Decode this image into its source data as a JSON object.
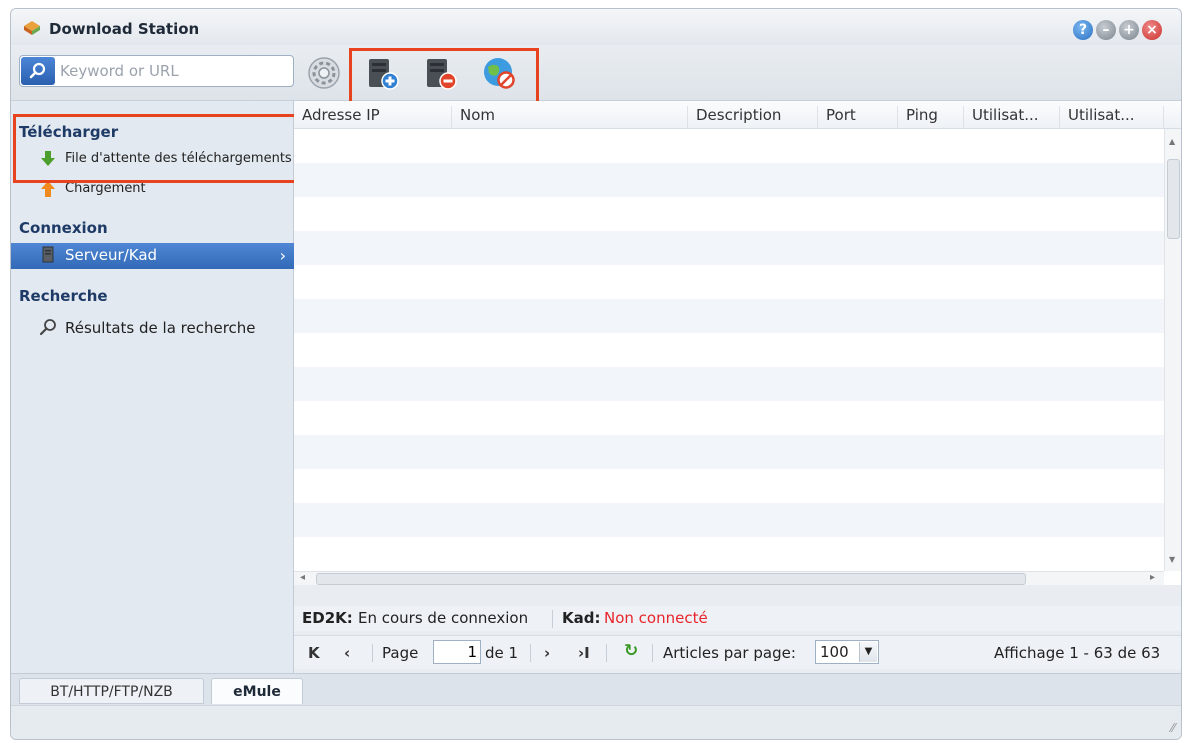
{
  "window": {
    "title": "Download Station",
    "controls": [
      "help",
      "minimize",
      "maximize",
      "close"
    ]
  },
  "colors": {
    "accent": "#336ab8",
    "highlight_box": "#e8431f",
    "status_error": "#e8252b"
  },
  "toolbar": {
    "search_placeholder": "Keyword or URL",
    "buttons": [
      {
        "icon": "gear-icon",
        "name": "settings"
      },
      {
        "icon": "add-server-icon",
        "name": "add-server"
      },
      {
        "icon": "remove-server-icon",
        "name": "remove-server"
      },
      {
        "icon": "block-network-icon",
        "name": "disconnect"
      }
    ]
  },
  "sidebar": {
    "sections": [
      {
        "title": "Télécharger",
        "items": [
          {
            "label": "File d'attente des téléchargements",
            "icon": "download-arrow-icon"
          },
          {
            "label": "Chargement",
            "icon": "upload-arrow-icon"
          }
        ]
      },
      {
        "title": "Connexion",
        "items": [
          {
            "label": "Serveur/Kad",
            "icon": "server-icon",
            "active": true
          }
        ]
      },
      {
        "title": "Recherche",
        "items": [
          {
            "label": "Résultats de la recherche",
            "icon": "search-icon"
          }
        ]
      }
    ]
  },
  "grid": {
    "columns": [
      "Adresse IP",
      "Nom",
      "Description",
      "Port",
      "Ping",
      "Utilisat...",
      "Utilisat..."
    ],
    "rows": []
  },
  "status": {
    "ed2k_label": "ED2K:",
    "ed2k_value": "En cours de connexion",
    "kad_label": "Kad:",
    "kad_value": "Non connecté"
  },
  "pager": {
    "page_label": "Page",
    "page_value": "1",
    "of_label": "de 1",
    "per_page_label": "Articles par page:",
    "per_page_value": "100",
    "display_text": "Affichage 1 - 63 de 63"
  },
  "bottom_tabs": [
    {
      "label": "BT/HTTP/FTP/NZB",
      "active": false
    },
    {
      "label": "eMule",
      "active": true
    }
  ]
}
